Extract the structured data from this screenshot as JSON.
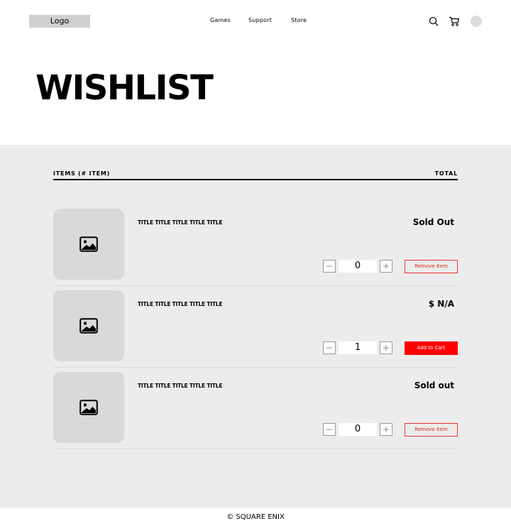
{
  "header": {
    "logo_label": "Logo",
    "nav": [
      "Games",
      "Support",
      "Store"
    ],
    "icons": [
      "search-icon",
      "cart-icon",
      "avatar"
    ]
  },
  "page_title": "WISHLIST",
  "columns": {
    "items_label": "ITEMS",
    "count_label": "(# ITEM)",
    "total_label": "TOTAL"
  },
  "items": [
    {
      "title": "TITLE TITLE TITLE TITLE TITLE",
      "status": "Sold Out",
      "quantity": "0",
      "action": "Remove Item",
      "action_style": "outline"
    },
    {
      "title": "TITLE TITLE TITLE TITLE TITLE",
      "status": "$ N/A",
      "quantity": "1",
      "action": "Add to Cart",
      "action_style": "filled"
    },
    {
      "title": "TITLE TITLE TITLE TITLE TITLE",
      "status": "Sold out",
      "quantity": "0",
      "action": "Remove Item",
      "action_style": "outline"
    }
  ],
  "colors": {
    "accent": "#ff0000",
    "panel": "#ececec",
    "thumb": "#d9d9d9"
  },
  "footer": "© SQUARE ENIX"
}
